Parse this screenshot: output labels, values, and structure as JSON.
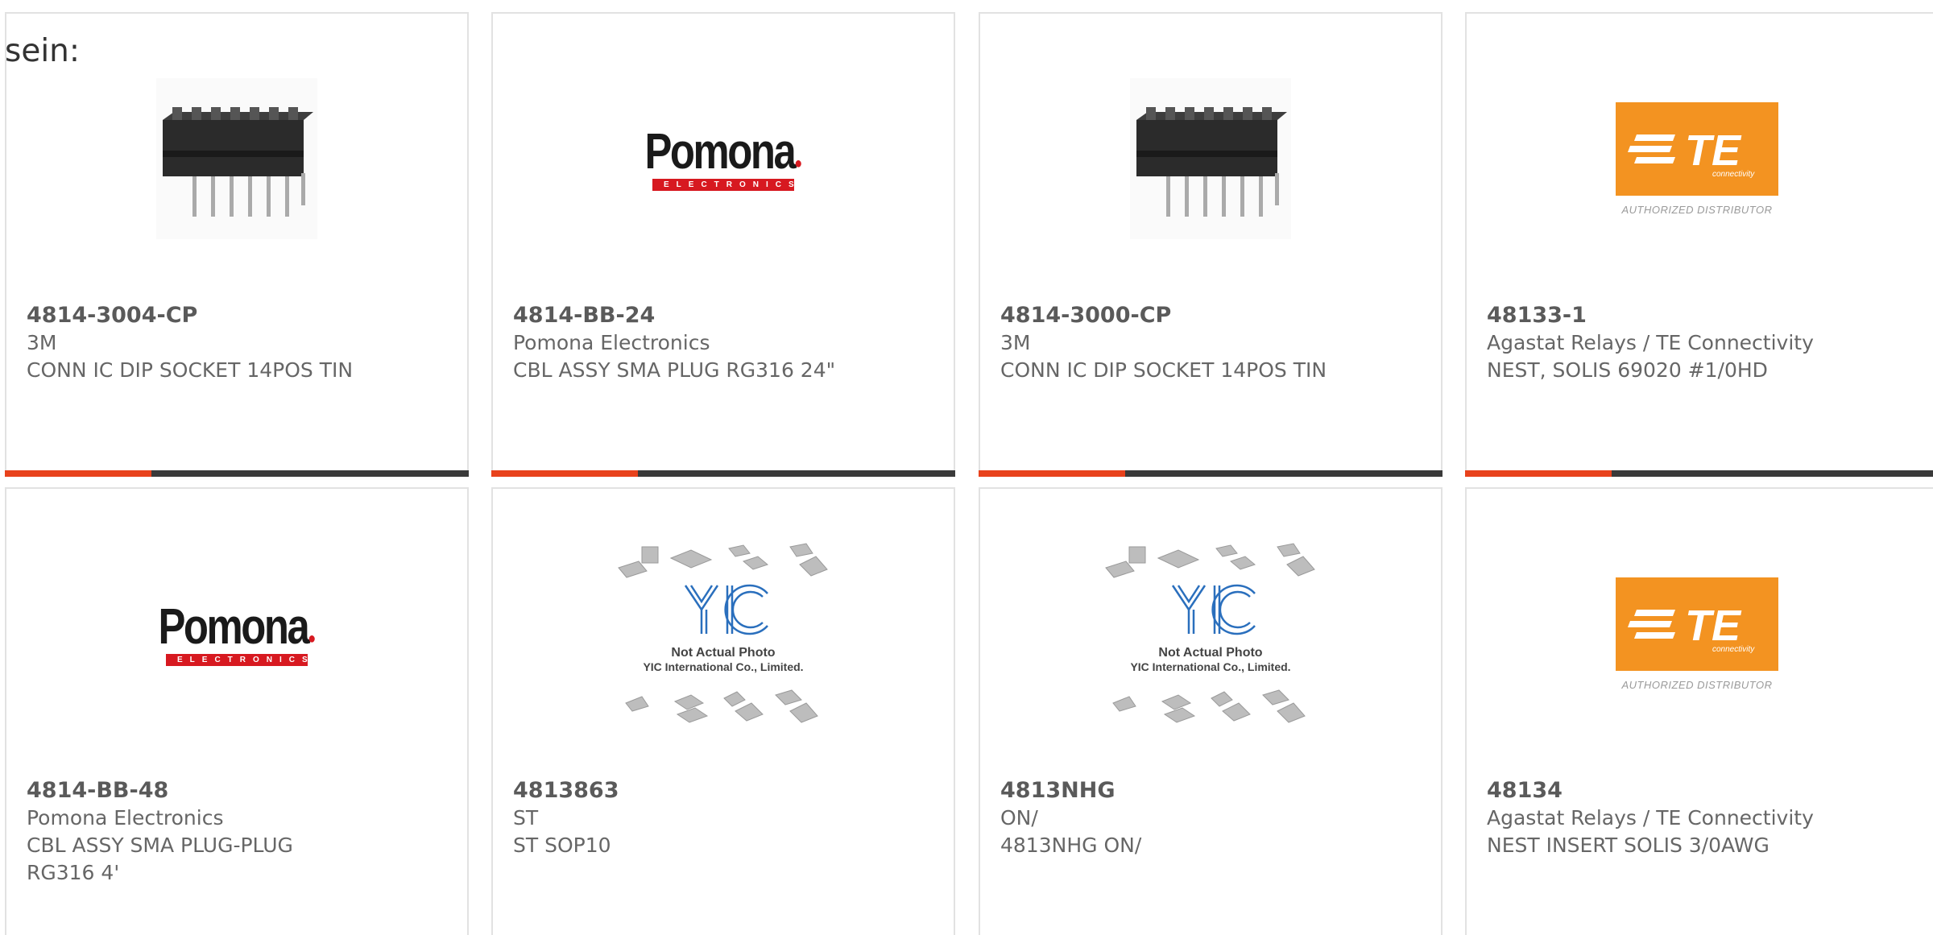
{
  "lead_text": "sein:",
  "colors": {
    "accent": "#e8421c",
    "bar": "#3a3a3a",
    "border": "#e2e2e2",
    "pomona_red": "#d71920",
    "te_orange": "#f39321"
  },
  "logos": {
    "pomona": {
      "word": "Pomona",
      "sub": "ELECTRONICS"
    },
    "te": {
      "word": "TE",
      "sub": "connectivity",
      "caption": "AUTHORIZED DISTRIBUTOR"
    },
    "yic": {
      "line1": "Not Actual Photo",
      "line2": "YIC International Co., Limited."
    }
  },
  "products": [
    {
      "part": "4814-3004-CP",
      "maker": "3M",
      "desc": "CONN IC DIP SOCKET 14POS TIN",
      "image": "dip-socket-icon"
    },
    {
      "part": "4814-BB-24",
      "maker": "Pomona Electronics",
      "desc": "CBL ASSY SMA PLUG RG316 24\"",
      "image": "pomona-logo"
    },
    {
      "part": "4814-3000-CP",
      "maker": "3M",
      "desc": "CONN IC DIP SOCKET 14POS TIN",
      "image": "dip-socket-icon"
    },
    {
      "part": "48133-1",
      "maker": "Agastat Relays / TE Connectivity",
      "desc": "NEST, SOLIS 69020 #1/0HD",
      "image": "te-logo"
    },
    {
      "part": "4814-BB-48",
      "maker": "Pomona Electronics",
      "desc": "CBL ASSY SMA PLUG-PLUG",
      "desc2": "RG316 4'",
      "image": "pomona-logo"
    },
    {
      "part": "4813863",
      "maker": "ST",
      "desc": "ST SOP10",
      "image": "placeholder"
    },
    {
      "part": "4813NHG",
      "maker": "ON/",
      "desc": "4813NHG ON/",
      "image": "placeholder"
    },
    {
      "part": "48134",
      "maker": "Agastat Relays / TE Connectivity",
      "desc": "NEST INSERT SOLIS 3/0AWG",
      "image": "te-logo"
    }
  ]
}
